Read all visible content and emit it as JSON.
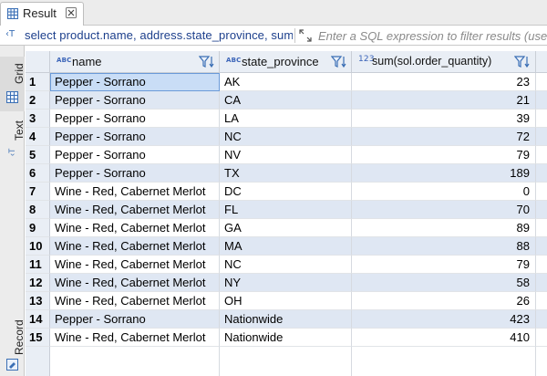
{
  "tab": {
    "label": "Result"
  },
  "filter": {
    "sql_text": "select product.name, address.state_province, sum(sol.order_quantity) ...",
    "placeholder": "Enter a SQL expression to filter results (use Ctrl+Space)"
  },
  "side_tabs": {
    "grid": "Grid",
    "text": "Text",
    "record": "Record"
  },
  "columns": [
    {
      "label": "name",
      "type_badge": "ABC"
    },
    {
      "label": "state_province",
      "type_badge": "ABC"
    },
    {
      "label": "sum(sol.order_quantity)",
      "type_badge": "123"
    }
  ],
  "rows": [
    {
      "num": "1",
      "name": "Pepper - Sorrano",
      "state": "AK",
      "sum": "23"
    },
    {
      "num": "2",
      "name": "Pepper - Sorrano",
      "state": "CA",
      "sum": "21"
    },
    {
      "num": "3",
      "name": "Pepper - Sorrano",
      "state": "LA",
      "sum": "39"
    },
    {
      "num": "4",
      "name": "Pepper - Sorrano",
      "state": "NC",
      "sum": "72"
    },
    {
      "num": "5",
      "name": "Pepper - Sorrano",
      "state": "NV",
      "sum": "79"
    },
    {
      "num": "6",
      "name": "Pepper - Sorrano",
      "state": "TX",
      "sum": "189"
    },
    {
      "num": "7",
      "name": "Wine - Red, Cabernet Merlot",
      "state": "DC",
      "sum": "0"
    },
    {
      "num": "8",
      "name": "Wine - Red, Cabernet Merlot",
      "state": "FL",
      "sum": "70"
    },
    {
      "num": "9",
      "name": "Wine - Red, Cabernet Merlot",
      "state": "GA",
      "sum": "89"
    },
    {
      "num": "10",
      "name": "Wine - Red, Cabernet Merlot",
      "state": "MA",
      "sum": "88"
    },
    {
      "num": "11",
      "name": "Wine - Red, Cabernet Merlot",
      "state": "NC",
      "sum": "79"
    },
    {
      "num": "12",
      "name": "Wine - Red, Cabernet Merlot",
      "state": "NY",
      "sum": "58"
    },
    {
      "num": "13",
      "name": "Wine - Red, Cabernet Merlot",
      "state": "OH",
      "sum": "26"
    },
    {
      "num": "14",
      "name": "Pepper - Sorrano",
      "state": "Nationwide",
      "sum": "423"
    },
    {
      "num": "15",
      "name": "Wine - Red, Cabernet Merlot",
      "state": "Nationwide",
      "sum": "410"
    }
  ],
  "colors": {
    "accent": "#3b6fb5",
    "sql_text": "#1c3f8c",
    "row_alt": "#dfe7f3",
    "selected": "#c9ddf6"
  },
  "icons": {
    "tab": "table-grid-icon",
    "close": "close-x-icon",
    "sql": "sql-console-icon",
    "expand": "expand-arrows-icon",
    "column_filter": "column-filter-sort-icon",
    "grid_panel": "grid-view-icon",
    "text_panel": "text-view-icon",
    "record_panel": "record-view-icon"
  }
}
